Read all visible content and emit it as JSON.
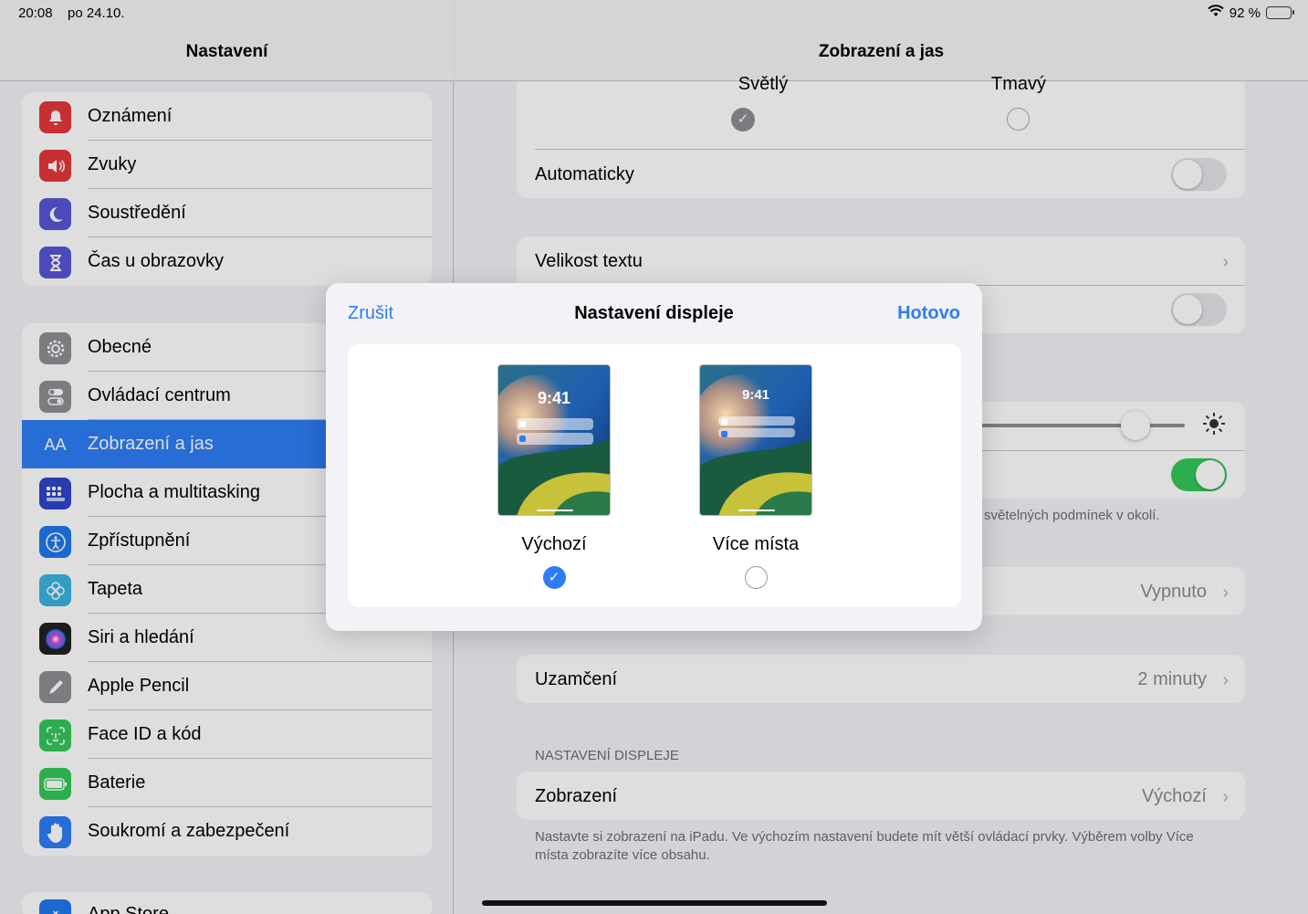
{
  "status": {
    "time": "20:08",
    "date": "po 24.10.",
    "battery": "92 %"
  },
  "sidebar": {
    "title": "Nastavení",
    "group1": [
      {
        "label": "Oznámení",
        "icon": "bell-icon",
        "color": "#e5383b"
      },
      {
        "label": "Zvuky",
        "icon": "speaker-icon",
        "color": "#e5383b"
      },
      {
        "label": "Soustředění",
        "icon": "moon-icon",
        "color": "#5856d6"
      },
      {
        "label": "Čas u obrazovky",
        "icon": "hourglass-icon",
        "color": "#5856d6"
      }
    ],
    "group2": [
      {
        "label": "Obecné",
        "icon": "gear-icon",
        "color": "#8e8e93"
      },
      {
        "label": "Ovládací centrum",
        "icon": "switches-icon",
        "color": "#8e8e93"
      },
      {
        "label": "Zobrazení a jas",
        "icon": "text-size-icon",
        "color": "#2f7cf6"
      },
      {
        "label": "Plocha a multitasking",
        "icon": "grid-icon",
        "color": "#2f44c9"
      },
      {
        "label": "Zpřístupnění",
        "icon": "accessibility-icon",
        "color": "#1f78ef"
      },
      {
        "label": "Tapeta",
        "icon": "flower-icon",
        "color": "#3ab4e0"
      },
      {
        "label": "Siri a hledání",
        "icon": "siri-icon",
        "color": "#222"
      },
      {
        "label": "Apple Pencil",
        "icon": "pencil-icon",
        "color": "#8e8e93"
      },
      {
        "label": "Face ID a kód",
        "icon": "faceid-icon",
        "color": "#34c759"
      },
      {
        "label": "Baterie",
        "icon": "battery-icon",
        "color": "#34c759"
      },
      {
        "label": "Soukromí a zabezpečení",
        "icon": "hand-icon",
        "color": "#2f7cf6"
      }
    ],
    "group3_partial": "App Store"
  },
  "main": {
    "title": "Zobrazení a jas",
    "appearance": {
      "light": "Světlý",
      "dark": "Tmavý",
      "auto": "Automaticky"
    },
    "text_size": "Velikost textu",
    "brightness_note": "světelných podmínek v okolí.",
    "night_shift_value": "Vypnuto",
    "lock": {
      "label": "Uzamčení",
      "value": "2 minuty"
    },
    "display_section": "NASTAVENÍ DISPLEJE",
    "display": {
      "label": "Zobrazení",
      "value": "Výchozí"
    },
    "display_note": "Nastavte si zobrazení na iPadu. Ve výchozím nastavení budete mít větší ovládací prvky. Výběrem volby Více místa zobrazíte více obsahu."
  },
  "modal": {
    "cancel": "Zrušit",
    "title": "Nastavení displeje",
    "done": "Hotovo",
    "options": [
      {
        "label": "Výchozí",
        "clock": "9:41",
        "selected": true
      },
      {
        "label": "Více místa",
        "clock": "9:41",
        "selected": false
      }
    ]
  }
}
